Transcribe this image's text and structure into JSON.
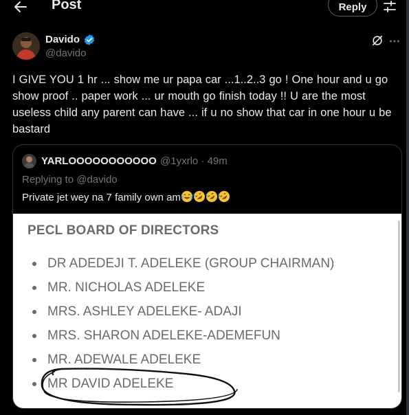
{
  "header": {
    "title": "Post",
    "reply_label": "Reply"
  },
  "post": {
    "author_name": "Davido",
    "author_handle": "@davido",
    "text": "I GIVE YOU 1 hr ... show me ur papa car ...1..2..3 go ! One hour and u go show proof  .. paper work ... ur mouth  go finish today !! U are the most useless child any parent  can have ... if u no show that  car in one hour u be bastard"
  },
  "quote": {
    "author_name": "YARLOOOOOOOOOOO",
    "meta": "@1yxrlo · 49m",
    "replying_to": "Replying to @davido",
    "text": "Private jet wey na 7 family own am",
    "emoji_icons": [
      "face-with-tears-of-joy",
      "rolling-on-floor-laughing",
      "rolling-on-floor-laughing",
      "rolling-on-floor-laughing"
    ],
    "image": {
      "heading": "PECL BOARD OF DIRECTORS",
      "items": [
        "DR ADEDEJI T. ADELEKE (GROUP CHAIRMAN)",
        "MR. NICHOLAS ADELEKE",
        "MRS. ASHLEY ADELEKE- ADAJI",
        "MRS. SHARON ADELEKE-ADEMEFUN",
        "MR. ADEWALE ADELEKE",
        "MR DAVID ADELEKE"
      ]
    }
  },
  "colors": {
    "background": "#000000",
    "text": "#e7e9ea",
    "muted": "#71767b",
    "border": "#2f3336",
    "verified": "#1d9bf0"
  }
}
